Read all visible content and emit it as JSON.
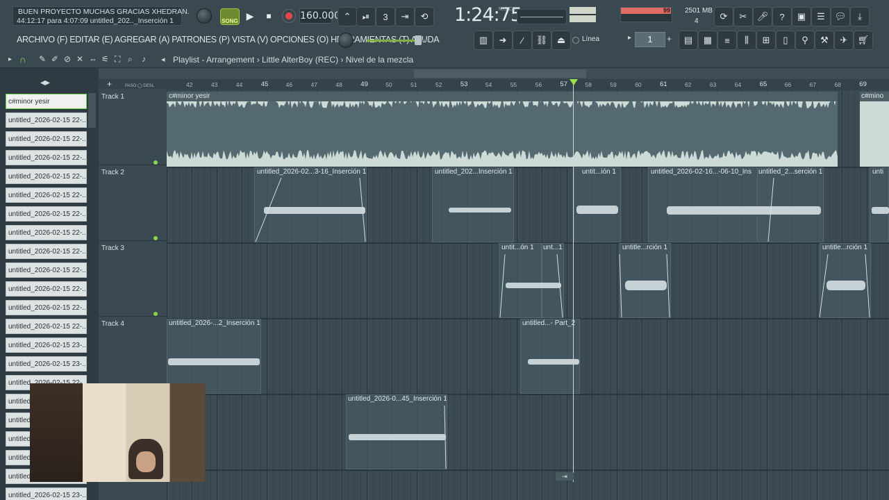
{
  "hint_bar": {
    "line1": "BUEN PROYECTO MUCHAS GRACIAS XHEDRAN.",
    "line2": "44:12:17 para 4:07:09    untitled_202.._Inserción 1"
  },
  "transport": {
    "song_label": "SONG",
    "bpm": "160.000",
    "time": "1:24:75",
    "time_unit": "M:S:CS",
    "play_icon": "play-icon",
    "stop_icon": "stop-icon",
    "record_icon": "record-icon"
  },
  "performance": {
    "cpu_value": "99",
    "memory": "2501 MB",
    "polyphony": "4"
  },
  "menu": {
    "text": "ARCHIVO (F) EDITAR (E) AGREGAR (A) PATRONES (P) VISTA (V) OPCIONES (O) HERRAMIENTAS (T) AYUDA",
    "snap_mode": "Línea",
    "step_value": "1"
  },
  "playlist": {
    "title": "Playlist - Arrangement  ›  Little AlterBoy (REC)  ›  Nivel de la mezcla"
  },
  "browser": {
    "items": [
      "c#minor yesir",
      "untitled_2026-02-15 22-...",
      "untitled_2026-02-15 22-...",
      "untitled_2026-02-15 22-...",
      "untitled_2026-02-15 22-...",
      "untitled_2026-02-15 22-...",
      "untitled_2026-02-15 22-...",
      "untitled_2026-02-15 22-...",
      "untitled_2026-02-15 22-...",
      "untitled_2026-02-15 22-...",
      "untitled_2026-02-15 22-...",
      "untitled_2026-02-15 22-...",
      "untitled_2026-02-15 22-...",
      "untitled_2026-02-15 23-...",
      "untitled_2026-02-15 23-...",
      "untitled_2026-02-15 22-...",
      "untitled",
      "untitled",
      "untitled",
      "untitled",
      "untitled",
      "untitled_2026-02-15 23-..."
    ]
  },
  "tracks": [
    {
      "name": "Track 1"
    },
    {
      "name": "Track 2"
    },
    {
      "name": "Track 3"
    },
    {
      "name": "Track 4"
    }
  ],
  "ruler": {
    "labels": [
      "42",
      "43",
      "44",
      "45",
      "46",
      "47",
      "48",
      "49",
      "50",
      "51",
      "52",
      "53",
      "54",
      "55",
      "56",
      "57",
      "58",
      "59",
      "60",
      "61",
      "62",
      "63",
      "64",
      "65",
      "66",
      "67",
      "68",
      "69"
    ],
    "major": [
      "45",
      "49",
      "53",
      "57",
      "61",
      "65",
      "69"
    ]
  },
  "clips": {
    "t1_main": "c#minor yesir",
    "t1_next": "c#mino",
    "t2_a": "untitled_2026-02...3-16_Inserción 1",
    "t2_b": "untitled_202...Inserción 1",
    "t2_c": "untit...ión 1",
    "t2_d": "untitled_2026-02-16...-06-10_Ins",
    "t2_e": "untitled_2...serción 1",
    "t2_f": "unti",
    "t3_a": "untit...ón 1",
    "t3_b": "unt...1",
    "t3_c": "untitle...rción 1",
    "t3_d": "untitle...rción 1",
    "t4_a": "untitled_2026-...2_Inserción 1",
    "t4_b": "untitled...- Part_2",
    "t5_a": "untitled_2026-0...45_Inserción 1"
  },
  "colors": {
    "accent_green": "#9be04a",
    "cpu_red": "#e06a64",
    "background": "#34434c"
  }
}
